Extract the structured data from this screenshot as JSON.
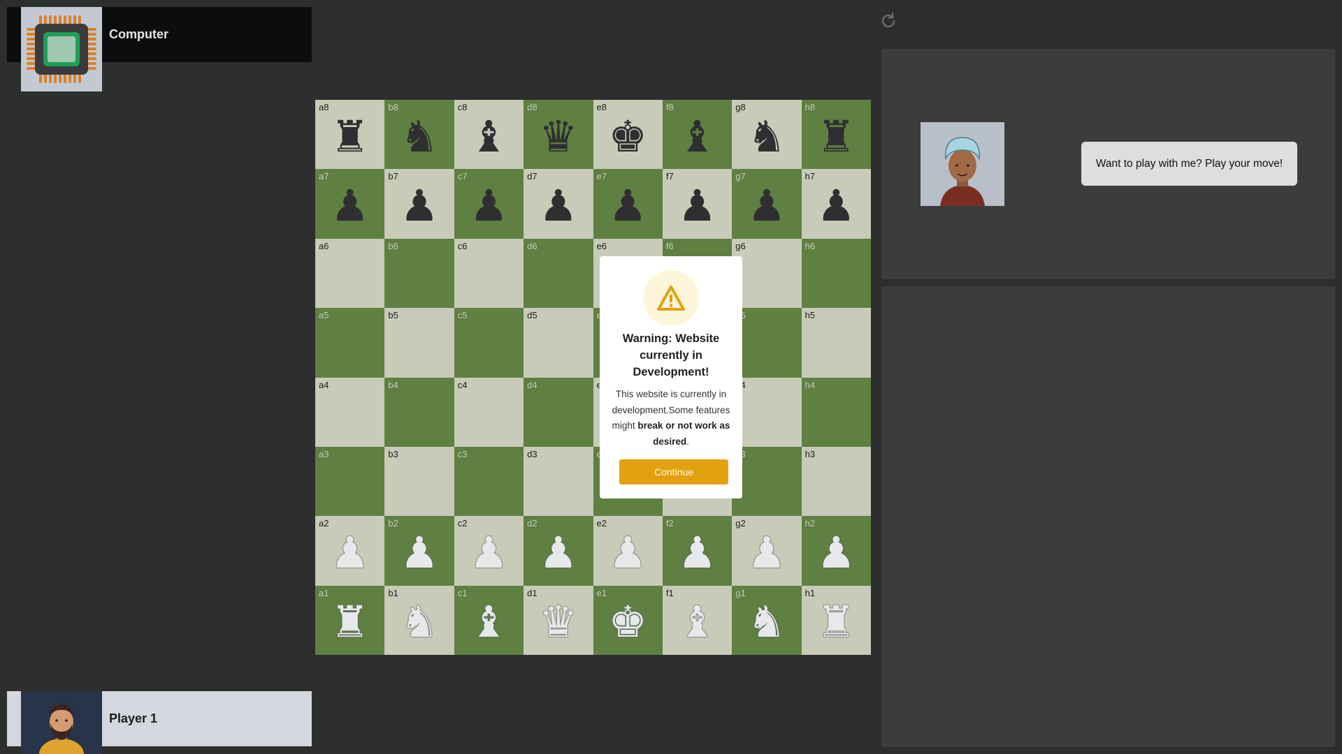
{
  "players": {
    "opponent": {
      "name": "Computer"
    },
    "self": {
      "name": "Player 1"
    }
  },
  "board": {
    "files": [
      "a",
      "b",
      "c",
      "d",
      "e",
      "f",
      "g",
      "h"
    ],
    "ranks": [
      "8",
      "7",
      "6",
      "5",
      "4",
      "3",
      "2",
      "1"
    ],
    "light_color": "#c8cbb8",
    "dark_color": "#5f7f43",
    "pieces": {
      "a8": "black-rook",
      "b8": "black-knight",
      "c8": "black-bishop",
      "d8": "black-queen",
      "e8": "black-king",
      "f8": "black-bishop",
      "g8": "black-knight",
      "h8": "black-rook",
      "a7": "black-pawn",
      "b7": "black-pawn",
      "c7": "black-pawn",
      "d7": "black-pawn",
      "e7": "black-pawn",
      "f7": "black-pawn",
      "g7": "black-pawn",
      "h7": "black-pawn",
      "a2": "white-pawn",
      "b2": "white-pawn",
      "c2": "white-pawn",
      "d2": "white-pawn",
      "e2": "white-pawn",
      "f2": "white-pawn",
      "g2": "white-pawn",
      "h2": "white-pawn",
      "a1": "white-rook",
      "b1": "white-knight",
      "c1": "white-bishop",
      "d1": "white-queen",
      "e1": "white-king",
      "f1": "white-bishop",
      "g1": "white-knight",
      "h1": "white-rook"
    }
  },
  "modal": {
    "icon": "warning-icon",
    "title": "Warning: Website currently in Development!",
    "body_start": "This website is currently in development.Some features might ",
    "body_bold": "break or not work as desired",
    "body_end": ".",
    "button_label": "Continue",
    "accent": "#e2a10f"
  },
  "chat": {
    "message": "Want to play with me? Play your move!"
  },
  "toolbar": {
    "refresh_icon": "refresh-icon"
  }
}
